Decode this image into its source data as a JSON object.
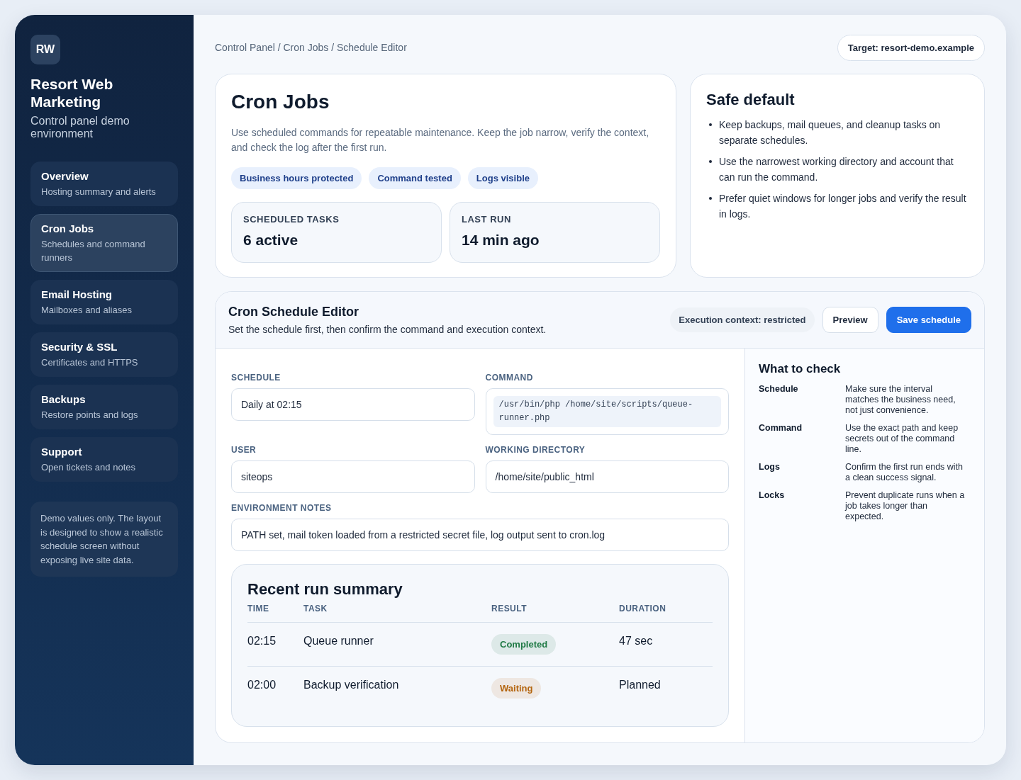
{
  "brand": {
    "logo": "RW",
    "title": "Resort Web Marketing",
    "subtitle": "Control panel demo environment"
  },
  "nav": [
    {
      "label": "Overview",
      "description": "Hosting summary and alerts",
      "selected": false
    },
    {
      "label": "Cron Jobs",
      "description": "Schedules and command runners",
      "selected": true
    },
    {
      "label": "Email Hosting",
      "description": "Mailboxes and aliases",
      "selected": false
    },
    {
      "label": "Security & SSL",
      "description": "Certificates and HTTPS",
      "selected": false
    },
    {
      "label": "Backups",
      "description": "Restore points and logs",
      "selected": false
    },
    {
      "label": "Support",
      "description": "Open tickets and notes",
      "selected": false
    }
  ],
  "sidebar_note": "Demo values only. The layout is designed to show a realistic schedule screen without exposing live site data.",
  "breadcrumb": "Control Panel / Cron Jobs / Schedule Editor",
  "target": "Target: resort-demo.example",
  "intro": {
    "title": "Cron Jobs",
    "description": "Use scheduled commands for repeatable maintenance. Keep the job narrow, verify the context, and check the log after the first run.",
    "tags": [
      "Business hours protected",
      "Command tested",
      "Logs visible"
    ],
    "stats": [
      {
        "label": "SCHEDULED TASKS",
        "value": "6 active"
      },
      {
        "label": "LAST RUN",
        "value": "14 min ago"
      }
    ]
  },
  "safe_default": {
    "title": "Safe default",
    "items": [
      "Keep backups, mail queues, and cleanup tasks on separate schedules.",
      "Use the narrowest working directory and account that can run the command.",
      "Prefer quiet windows for longer jobs and verify the result in logs."
    ]
  },
  "editor": {
    "title": "Cron Schedule Editor",
    "subtitle": "Set the schedule first, then confirm the command and execution context.",
    "context": "Execution context: restricted",
    "buttons": [
      {
        "label": "Preview",
        "kind": "secondary"
      },
      {
        "label": "Save schedule",
        "kind": "primary"
      }
    ],
    "field_rows": [
      {
        "fields": [
          {
            "label": "SCHEDULE",
            "value": "Daily at 02:15",
            "kind": "text"
          },
          {
            "label": "COMMAND",
            "value": "/usr/bin/php /home/site/scripts/queue-runner.php",
            "kind": "code"
          }
        ]
      },
      {
        "fields": [
          {
            "label": "USER",
            "value": "siteops",
            "kind": "text"
          },
          {
            "label": "WORKING DIRECTORY",
            "value": "/home/site/public_html",
            "kind": "text"
          }
        ]
      },
      {
        "fields": [
          {
            "label": "ENVIRONMENT NOTES",
            "value": "PATH set, mail token loaded from a restricted secret file, log output sent to cron.log",
            "kind": "text"
          }
        ]
      }
    ]
  },
  "recent_runs": {
    "title": "Recent run summary",
    "columns": [
      "TIME",
      "TASK",
      "RESULT",
      "DURATION"
    ],
    "rows": [
      {
        "time": "02:15",
        "task": "Queue runner",
        "result": {
          "label": "Completed",
          "color": "#1f7a45"
        },
        "duration": "47 sec"
      },
      {
        "time": "02:00",
        "task": "Backup verification",
        "result": {
          "label": "Waiting",
          "color": "#b4650f"
        },
        "duration": "Planned"
      }
    ]
  },
  "checklist": {
    "title": "What to check",
    "items": [
      {
        "term": "Schedule",
        "description": "Make sure the interval matches the business need, not just convenience."
      },
      {
        "term": "Command",
        "description": "Use the exact path and keep secrets out of the command line."
      },
      {
        "term": "Logs",
        "description": "Confirm the first run ends with a clean success signal."
      },
      {
        "term": "Locks",
        "description": "Prevent duplicate runs when a job takes longer than expected."
      }
    ]
  }
}
